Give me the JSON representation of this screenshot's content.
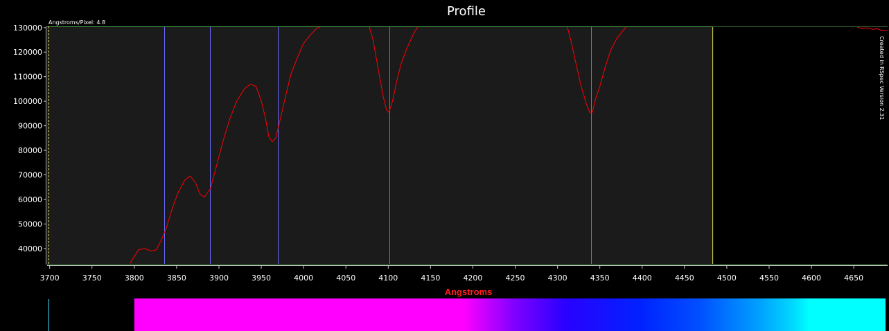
{
  "chart_data": {
    "type": "line",
    "title": "Profile",
    "xlabel": "Angstroms",
    "ylabel": "",
    "annotation_top_left": "Angstroms/Pixel: 4.8",
    "annotation_right": "Created in RSpec Version 2.31",
    "xlim": [
      3697,
      4690
    ],
    "ylim": [
      33500,
      130500
    ],
    "x_ticks": [
      3700,
      3750,
      3800,
      3850,
      3900,
      3950,
      4000,
      4050,
      4100,
      4150,
      4200,
      4250,
      4300,
      4350,
      4400,
      4450,
      4500,
      4550,
      4600,
      4650
    ],
    "y_ticks": [
      40000,
      50000,
      60000,
      70000,
      80000,
      90000,
      100000,
      110000,
      120000,
      130000
    ],
    "highlight_region": [
      3697,
      4483
    ],
    "reference_lines": [
      3835,
      3889,
      3970,
      4101,
      4340
    ],
    "series": [
      {
        "color": "#ff0000",
        "x": [
          3795,
          3805,
          3812,
          3820,
          3826,
          3832,
          3838,
          3845,
          3852,
          3860,
          3866,
          3872,
          3878,
          3883,
          3890,
          3897,
          3905,
          3913,
          3921,
          3930,
          3937,
          3944,
          3950,
          3955,
          3959,
          3963,
          3967,
          3972,
          3978,
          3985,
          3993,
          4000,
          4008,
          4015,
          4023
        ],
        "y": [
          34000,
          39500,
          40000,
          39000,
          39500,
          43500,
          48500,
          56500,
          63000,
          68000,
          69500,
          67000,
          62000,
          61000,
          64500,
          73500,
          84000,
          93000,
          100000,
          105000,
          107000,
          106000,
          100000,
          93000,
          85500,
          83500,
          85000,
          92000,
          101000,
          111000,
          118000,
          123500,
          127000,
          129500,
          131000
        ]
      },
      {
        "color": "#ff0000",
        "x": [
          4077,
          4082,
          4088,
          4094,
          4098,
          4101,
          4105,
          4110,
          4115,
          4122,
          4130,
          4136
        ],
        "y": [
          131000,
          125000,
          113500,
          102000,
          96500,
          95500,
          100000,
          108000,
          115000,
          121500,
          127500,
          131000
        ]
      },
      {
        "color": "#ff0000",
        "x": [
          4311,
          4316,
          4322,
          4328,
          4334,
          4338,
          4341,
          4345,
          4350,
          4356,
          4363,
          4370,
          4378,
          4383
        ],
        "y": [
          131000,
          124500,
          115000,
          106000,
          99000,
          95500,
          95500,
          101000,
          106000,
          113500,
          121000,
          125500,
          129000,
          131000
        ]
      },
      {
        "color": "#ff0000",
        "x": [
          4654,
          4660,
          4665,
          4672,
          4678,
          4684,
          4690
        ],
        "y": [
          130200,
          129600,
          129900,
          129300,
          129500,
          128700,
          128900
        ]
      }
    ],
    "spectrum_strip": {
      "start_wavelength": 3800,
      "end_wavelength": 4690,
      "stops": [
        {
          "w": 3800,
          "color": "#ff00ff"
        },
        {
          "w": 4190,
          "color": "#ff00ff"
        },
        {
          "w": 4250,
          "color": "#8000ff"
        },
        {
          "w": 4310,
          "color": "#2a00ff"
        },
        {
          "w": 4400,
          "color": "#0022ff"
        },
        {
          "w": 4470,
          "color": "#0050ff"
        },
        {
          "w": 4540,
          "color": "#00a0ff"
        },
        {
          "w": 4580,
          "color": "#00d8ff"
        },
        {
          "w": 4600,
          "color": "#00ffff"
        },
        {
          "w": 4690,
          "color": "#00ffff"
        }
      ]
    },
    "colors": {
      "plot_background": "#1b1b1b",
      "page_background": "#000000",
      "frame": "#3d8b3d",
      "axis": "#cccccc",
      "reference_line": "#6a6aff",
      "region_edge": "#e8e85a",
      "xlabel": "#ff2020"
    }
  }
}
